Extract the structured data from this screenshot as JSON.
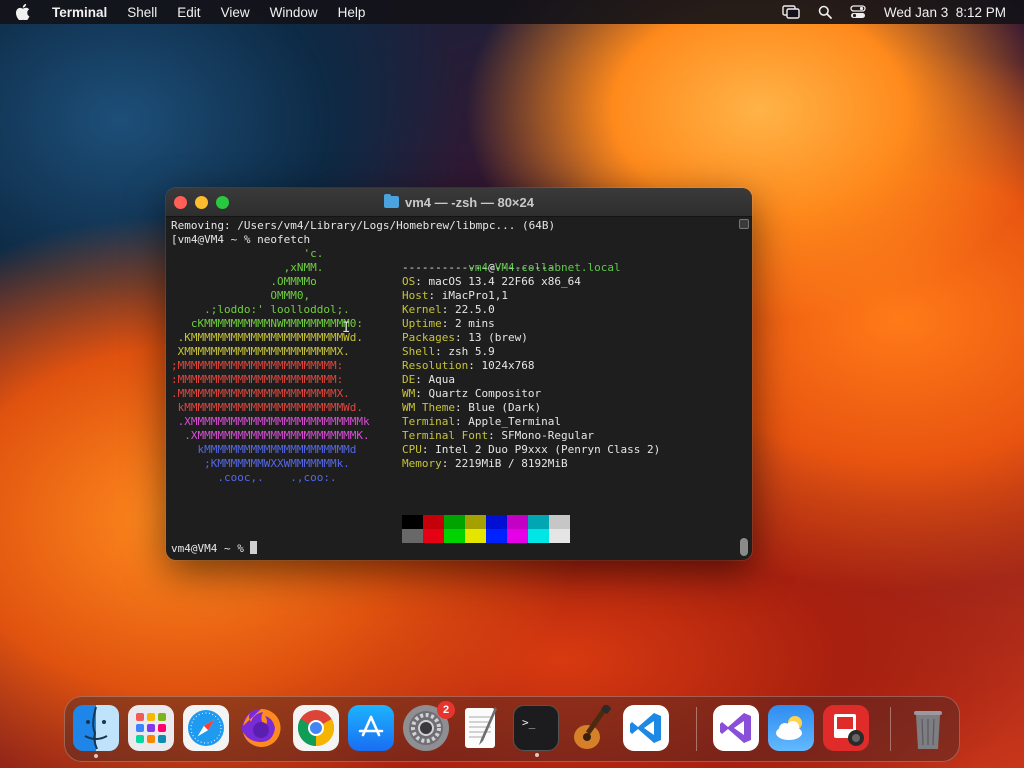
{
  "menubar": {
    "app_name": "Terminal",
    "items": [
      "Shell",
      "Edit",
      "View",
      "Window",
      "Help"
    ],
    "datetime": "Wed Jan 3  8:12 PM"
  },
  "window": {
    "title": "vm4 — -zsh — 80×24"
  },
  "terminal": {
    "line_removing": "Removing: /Users/vm4/Library/Logs/Homebrew/libmpc... (64B)",
    "line_cmd": "[vm4@VM4 ~ % neofetch",
    "logo_lines": [
      {
        "text": "                    'c.",
        "color": "#6fcf3f"
      },
      {
        "text": "                 ,xNMM.",
        "color": "#6fcf3f"
      },
      {
        "text": "               .OMMMMo",
        "color": "#6fcf3f"
      },
      {
        "text": "               OMMM0,",
        "color": "#6fcf3f"
      },
      {
        "text": "     .;loddo:' loolloddol;.",
        "color": "#6fcf3f"
      },
      {
        "text": "   cKMMMMMMMMMMNWMMMMMMMMMM0:",
        "color": "#6fcf3f"
      },
      {
        "text": " .KMMMMMMMMMMMMMMMMMMMMMMMWd.",
        "color": "#c7c43a"
      },
      {
        "text": " XMMMMMMMMMMMMMMMMMMMMMMMX.",
        "color": "#c7c43a"
      },
      {
        "text": ";MMMMMMMMMMMMMMMMMMMMMMMM:",
        "color": "#e0473d"
      },
      {
        "text": ":MMMMMMMMMMMMMMMMMMMMMMMM:",
        "color": "#e0473d"
      },
      {
        "text": ".MMMMMMMMMMMMMMMMMMMMMMMMX.",
        "color": "#e0473d"
      },
      {
        "text": " kMMMMMMMMMMMMMMMMMMMMMMMMWd.",
        "color": "#e0473d"
      },
      {
        "text": " .XMMMMMMMMMMMMMMMMMMMMMMMMMMk",
        "color": "#d94fd6"
      },
      {
        "text": "  .XMMMMMMMMMMMMMMMMMMMMMMMMK.",
        "color": "#d94fd6"
      },
      {
        "text": "    kMMMMMMMMMMMMMMMMMMMMMMd",
        "color": "#5468e8"
      },
      {
        "text": "     ;KMMMMMMMWXXWMMMMMMMk.",
        "color": "#5468e8"
      },
      {
        "text": "       .cooc,.    .,coo:.",
        "color": "#5468e8"
      }
    ],
    "host_user": "vm4",
    "host_at": "@",
    "host_name": "VM4.collabnet.local",
    "separator": "-----------------------",
    "info": [
      {
        "key": "OS",
        "value": "macOS 13.4 22F66 x86_64"
      },
      {
        "key": "Host",
        "value": "iMacPro1,1"
      },
      {
        "key": "Kernel",
        "value": "22.5.0"
      },
      {
        "key": "Uptime",
        "value": "2 mins"
      },
      {
        "key": "Packages",
        "value": "13 (brew)"
      },
      {
        "key": "Shell",
        "value": "zsh 5.9"
      },
      {
        "key": "Resolution",
        "value": "1024x768"
      },
      {
        "key": "DE",
        "value": "Aqua"
      },
      {
        "key": "WM",
        "value": "Quartz Compositor"
      },
      {
        "key": "WM Theme",
        "value": "Blue (Dark)"
      },
      {
        "key": "Terminal",
        "value": "Apple_Terminal"
      },
      {
        "key": "Terminal Font",
        "value": "SFMono-Regular"
      },
      {
        "key": "CPU",
        "value": "Intel 2 Duo P9xxx (Penryn Class 2)"
      },
      {
        "key": "Memory",
        "value": "2219MiB / 8192MiB"
      }
    ],
    "palette_dark": [
      "#000000",
      "#c4000b",
      "#00a400",
      "#a3a000",
      "#0010d2",
      "#c400c4",
      "#00a6b2",
      "#c6c6c6"
    ],
    "palette_bright": [
      "#686868",
      "#e50014",
      "#00d400",
      "#e5e500",
      "#0022ff",
      "#e500e5",
      "#00e5e5",
      "#e5e5e5"
    ],
    "prompt": "vm4@VM4 ~ % "
  },
  "dock": {
    "apps": [
      {
        "name": "finder-icon",
        "running": true
      },
      {
        "name": "launchpad-icon",
        "running": false
      },
      {
        "name": "safari-icon",
        "running": false
      },
      {
        "name": "firefox-icon",
        "running": false
      },
      {
        "name": "chrome-icon",
        "running": false
      },
      {
        "name": "app-store-icon",
        "running": false
      },
      {
        "name": "system-settings-icon",
        "running": false,
        "badge": "2"
      },
      {
        "name": "textedit-icon",
        "running": false
      },
      {
        "name": "terminal-icon",
        "running": true
      },
      {
        "name": "garageband-icon",
        "running": false
      },
      {
        "name": "vscode-icon",
        "running": false
      },
      {
        "name": "visual-studio-icon",
        "running": false
      },
      {
        "name": "weather-icon",
        "running": false
      },
      {
        "name": "photo-booth-icon",
        "running": false
      },
      {
        "name": "trash-icon",
        "running": false
      }
    ]
  }
}
